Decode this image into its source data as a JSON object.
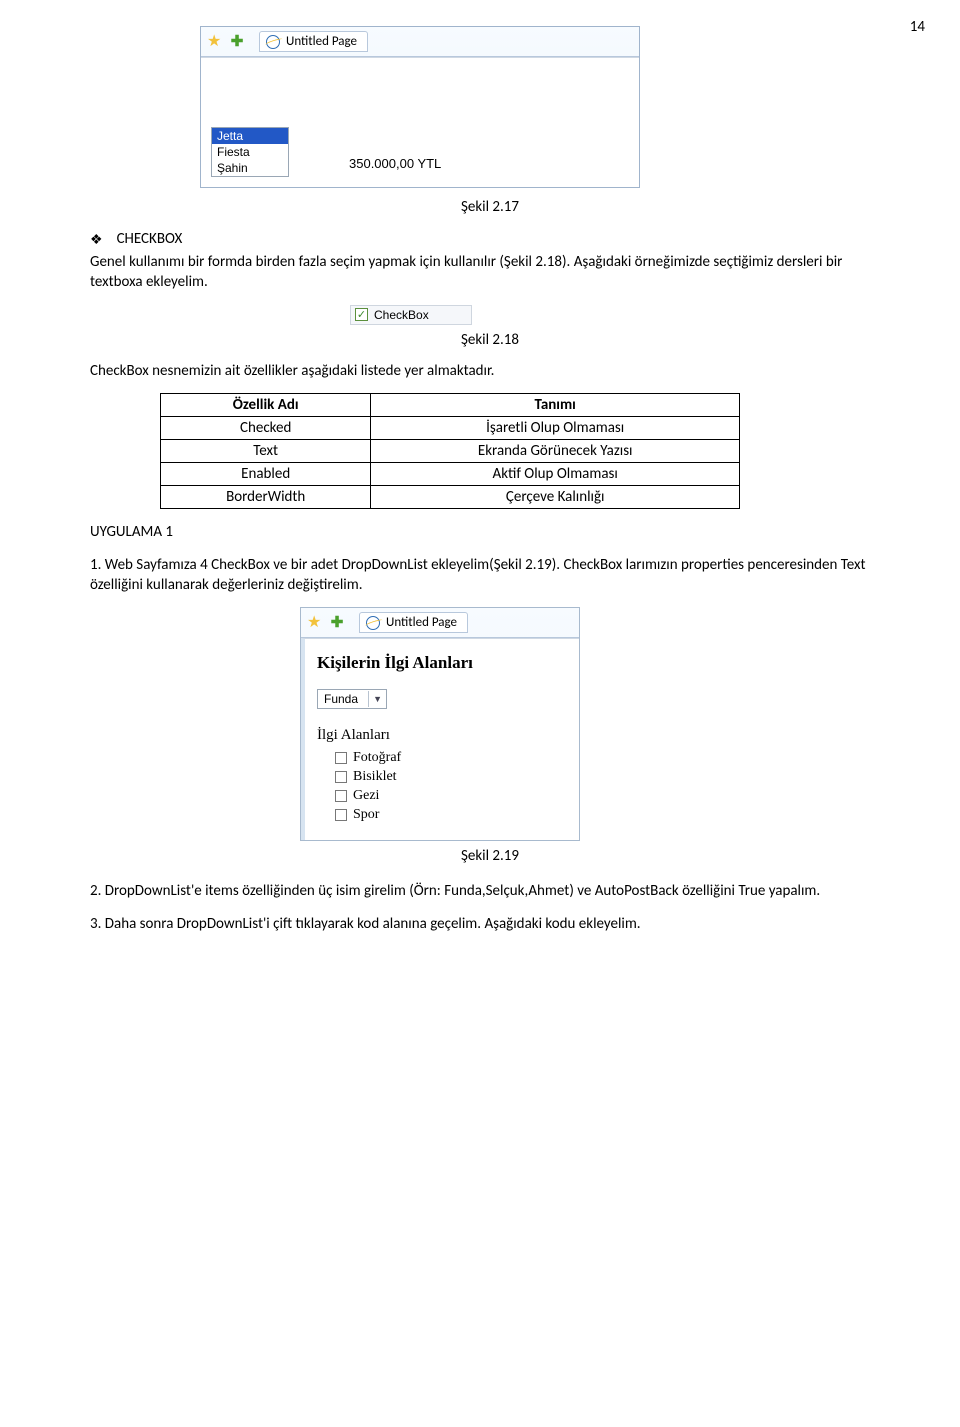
{
  "page_number": "14",
  "figure1": {
    "tab_title": "Untitled Page",
    "listbox": [
      "Jetta",
      "Fiesta",
      "Şahin"
    ],
    "listbox_selected": 0,
    "value_text": "350.000,00 YTL",
    "caption": "Şekil 2.17"
  },
  "checkbox_section": {
    "bullet_head": "CHECKBOX",
    "para1": "Genel kullanımı bir formda birden fazla seçim yapmak için kullanılır (Şekil 2.18). Aşağıdaki örneğimizde seçtiğimiz dersleri bir textboxa ekleyelim.",
    "checkbox_label": "CheckBox",
    "caption18": "Şekil 2.18",
    "para2": "CheckBox nesnemizin ait özellikler aşağıdaki listede yer almaktadır."
  },
  "property_table": {
    "header": [
      "Özellik Adı",
      "Tanımı"
    ],
    "rows": [
      [
        "Checked",
        "İşaretli Olup Olmaması"
      ],
      [
        "Text",
        "Ekranda Görünecek Yazısı"
      ],
      [
        "Enabled",
        "Aktif Olup Olmaması"
      ],
      [
        "BorderWidth",
        "Çerçeve Kalınlığı"
      ]
    ]
  },
  "uygulama_label": "UYGULAMA 1",
  "step1": "1. Web Sayfamıza 4 CheckBox ve bir adet DropDownList ekleyelim(Şekil 2.19). CheckBox larımızın properties penceresinden Text özelliğini kullanarak değerleriniz değiştirelim.",
  "figure2": {
    "tab_title": "Untitled Page",
    "heading": "Kişilerin İlgi Alanları",
    "dropdown_value": "Funda",
    "ilgi_heading": "İlgi Alanları",
    "options": [
      "Fotoğraf",
      "Bisiklet",
      "Gezi",
      "Spor"
    ],
    "caption": "Şekil 2.19"
  },
  "step2": "2. DropDownList'e items özelliğinden üç isim girelim (Örn: Funda,Selçuk,Ahmet) ve AutoPostBack özelliğini True yapalım.",
  "step3": "3. Daha sonra DropDownList'i çift tıklayarak kod alanına geçelim. Aşağıdaki kodu ekleyelim."
}
